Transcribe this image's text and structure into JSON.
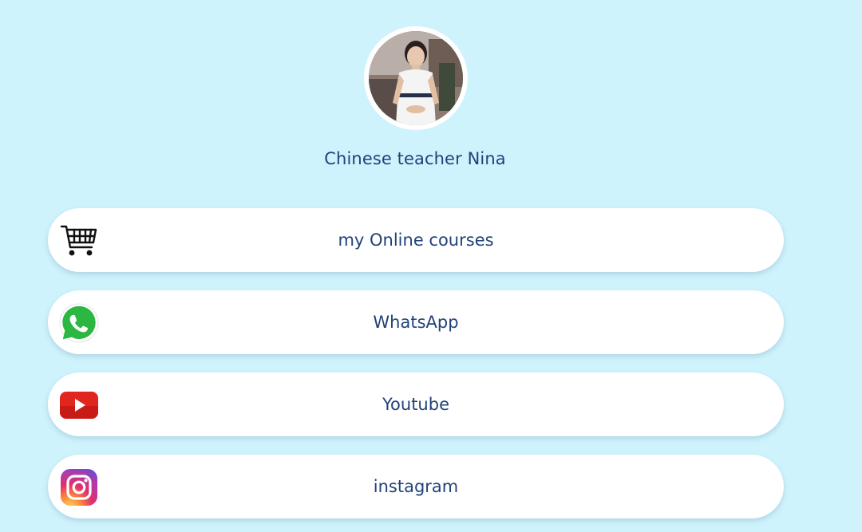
{
  "profile": {
    "name": "Chinese teacher Nina",
    "avatar": "teacher-portrait"
  },
  "links": [
    {
      "label": "my Online courses",
      "icon": "shopping-cart-icon"
    },
    {
      "label": "WhatsApp",
      "icon": "whatsapp-icon"
    },
    {
      "label": "Youtube",
      "icon": "youtube-icon"
    },
    {
      "label": "instagram",
      "icon": "instagram-icon"
    }
  ],
  "colors": {
    "background": "#cff3fd",
    "text": "#21427a",
    "button": "#ffffff",
    "whatsapp": "#2bb741",
    "youtube": "#e0261f"
  }
}
